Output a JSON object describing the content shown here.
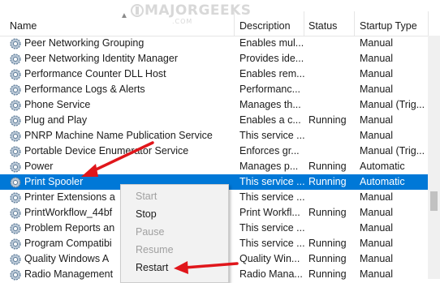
{
  "header": {
    "name": "Name",
    "description": "Description",
    "status": "Status",
    "startup_type": "Startup Type"
  },
  "watermark": {
    "text": "MAJORGEEKS",
    "sub": ".COM"
  },
  "rows": [
    {
      "name": "Peer Networking Grouping",
      "description": "Enables mul...",
      "status": "",
      "startup_type": "Manual"
    },
    {
      "name": "Peer Networking Identity Manager",
      "description": "Provides ide...",
      "status": "",
      "startup_type": "Manual"
    },
    {
      "name": "Performance Counter DLL Host",
      "description": "Enables rem...",
      "status": "",
      "startup_type": "Manual"
    },
    {
      "name": "Performance Logs & Alerts",
      "description": "Performanc...",
      "status": "",
      "startup_type": "Manual"
    },
    {
      "name": "Phone Service",
      "description": "Manages th...",
      "status": "",
      "startup_type": "Manual (Trig..."
    },
    {
      "name": "Plug and Play",
      "description": "Enables a c...",
      "status": "Running",
      "startup_type": "Manual"
    },
    {
      "name": "PNRP Machine Name Publication Service",
      "description": "This service ...",
      "status": "",
      "startup_type": "Manual"
    },
    {
      "name": "Portable Device Enumerator Service",
      "description": "Enforces gr...",
      "status": "",
      "startup_type": "Manual (Trig..."
    },
    {
      "name": "Power",
      "description": "Manages p...",
      "status": "Running",
      "startup_type": "Automatic"
    },
    {
      "name": "Print Spooler",
      "description": "This service ...",
      "status": "Running",
      "startup_type": "Automatic"
    },
    {
      "name": "Printer Extensions a",
      "description": "This service ...",
      "status": "",
      "startup_type": "Manual"
    },
    {
      "name": "PrintWorkflow_44bf",
      "description": "Print Workfl...",
      "status": "Running",
      "startup_type": "Manual"
    },
    {
      "name": "Problem Reports an",
      "description": "This service ...",
      "status": "",
      "startup_type": "Manual"
    },
    {
      "name": "Program Compatibi",
      "description": "This service ...",
      "status": "Running",
      "startup_type": "Manual"
    },
    {
      "name": "Quality Windows A",
      "description": "Quality Win...",
      "status": "Running",
      "startup_type": "Manual"
    },
    {
      "name": "Radio Management",
      "description": "Radio Mana...",
      "status": "Running",
      "startup_type": "Manual"
    }
  ],
  "selected_row": "Print Spooler",
  "context_menu": {
    "items": [
      {
        "label": "Start",
        "enabled": false
      },
      {
        "label": "Stop",
        "enabled": true
      },
      {
        "label": "Pause",
        "enabled": false
      },
      {
        "label": "Resume",
        "enabled": false
      },
      {
        "label": "Restart",
        "enabled": true
      }
    ]
  },
  "colors": {
    "selection": "#0078d7",
    "arrow": "#e0161b"
  },
  "icons": {
    "service": "gear-icon"
  }
}
